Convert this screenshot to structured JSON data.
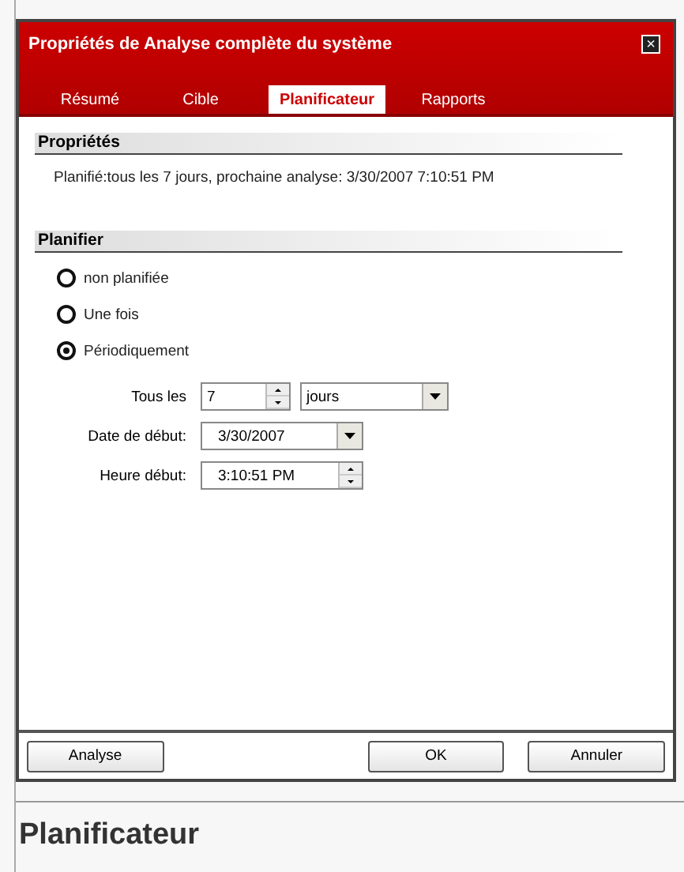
{
  "window": {
    "title": "Propriétés de Analyse complète du système",
    "close": "×"
  },
  "tabs": [
    {
      "label": "Résumé",
      "selected": false
    },
    {
      "label": "Cible",
      "selected": false
    },
    {
      "label": "Planificateur",
      "selected": true
    },
    {
      "label": "Rapports",
      "selected": false
    }
  ],
  "properties": {
    "heading": "Propriétés",
    "summary": "Planifié:tous les 7 jours, prochaine analyse: 3/30/2007 7:10:51 PM"
  },
  "schedule": {
    "heading": "Planifier",
    "options": [
      {
        "label": "non planifiée",
        "selected": false
      },
      {
        "label": "Une fois",
        "selected": false
      },
      {
        "label": "Périodiquement",
        "selected": true
      }
    ],
    "every": {
      "label": "Tous les",
      "value": "7",
      "unit": "jours"
    },
    "start_date": {
      "label": "Date de début:",
      "value": "3/30/2007"
    },
    "start_time": {
      "label": "Heure début:",
      "value": "3:10:51 PM"
    }
  },
  "buttons": [
    {
      "label": "Analyse"
    },
    {
      "label": "OK"
    },
    {
      "label": "Annuler"
    }
  ],
  "caption": "Planificateur"
}
